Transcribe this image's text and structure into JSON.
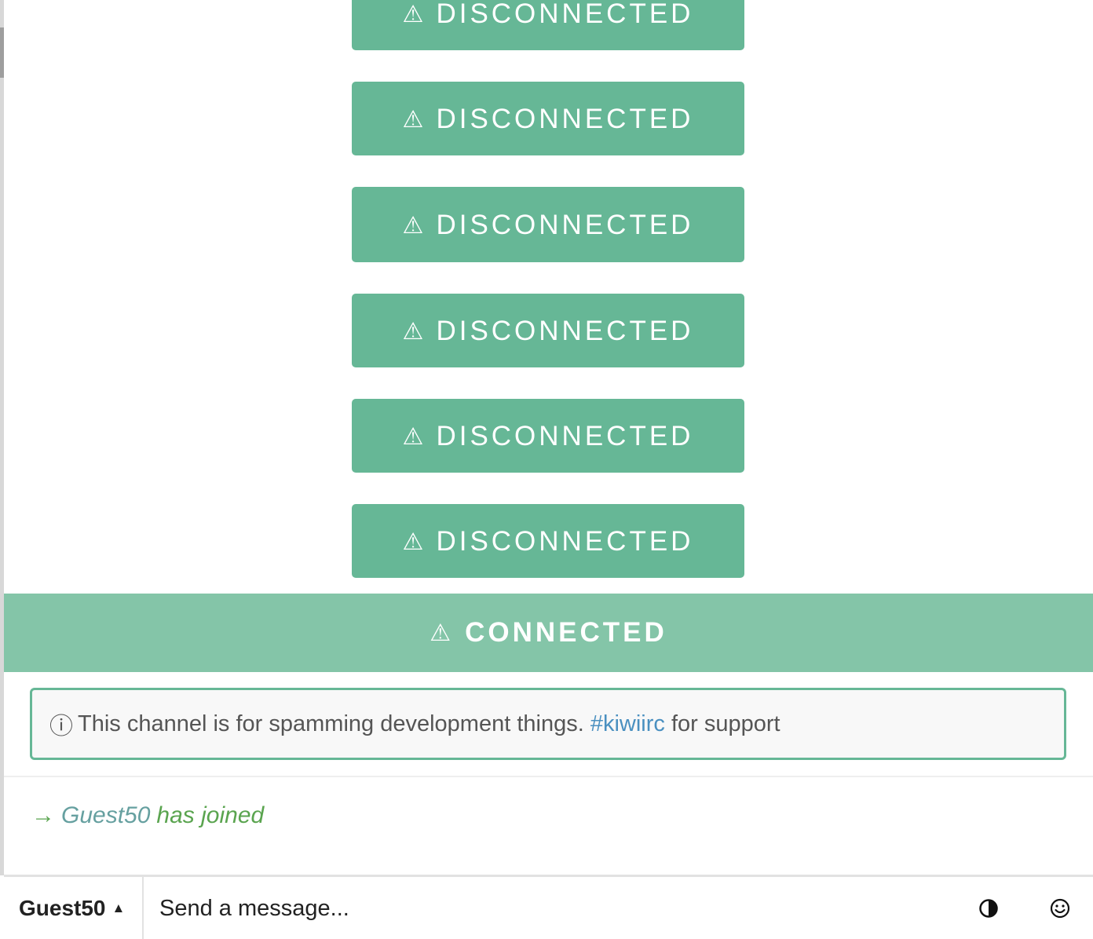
{
  "status_buttons": [
    {
      "icon": "warning-icon",
      "glyph": "⚠",
      "label": "DISCONNECTED"
    },
    {
      "icon": "warning-icon",
      "glyph": "⚠",
      "label": "DISCONNECTED"
    },
    {
      "icon": "warning-icon",
      "glyph": "⚠",
      "label": "DISCONNECTED"
    },
    {
      "icon": "warning-icon",
      "glyph": "⚠",
      "label": "DISCONNECTED"
    },
    {
      "icon": "warning-icon",
      "glyph": "⚠",
      "label": "DISCONNECTED"
    },
    {
      "icon": "warning-icon",
      "glyph": "⚠",
      "label": "DISCONNECTED"
    }
  ],
  "connected": {
    "icon": "warning-icon",
    "glyph": "⚠",
    "label": "CONNECTED"
  },
  "topic": {
    "icon": "info-icon",
    "glyph": "ⓘ",
    "text_before": "This channel is for spamming development things.",
    "channel_link": "#kiwiirc",
    "text_after": "for support"
  },
  "messages": [
    {
      "type": "join",
      "arrow": "→",
      "nick": "Guest50",
      "text": "has joined"
    }
  ],
  "input_bar": {
    "nick": "Guest50",
    "caret": "▲",
    "placeholder": "Send a message...",
    "value": ""
  },
  "colors": {
    "button_green": "#66b796",
    "connected_green": "#84c5a8",
    "link_blue": "#4a90c0",
    "join_green": "#5aa44f"
  }
}
